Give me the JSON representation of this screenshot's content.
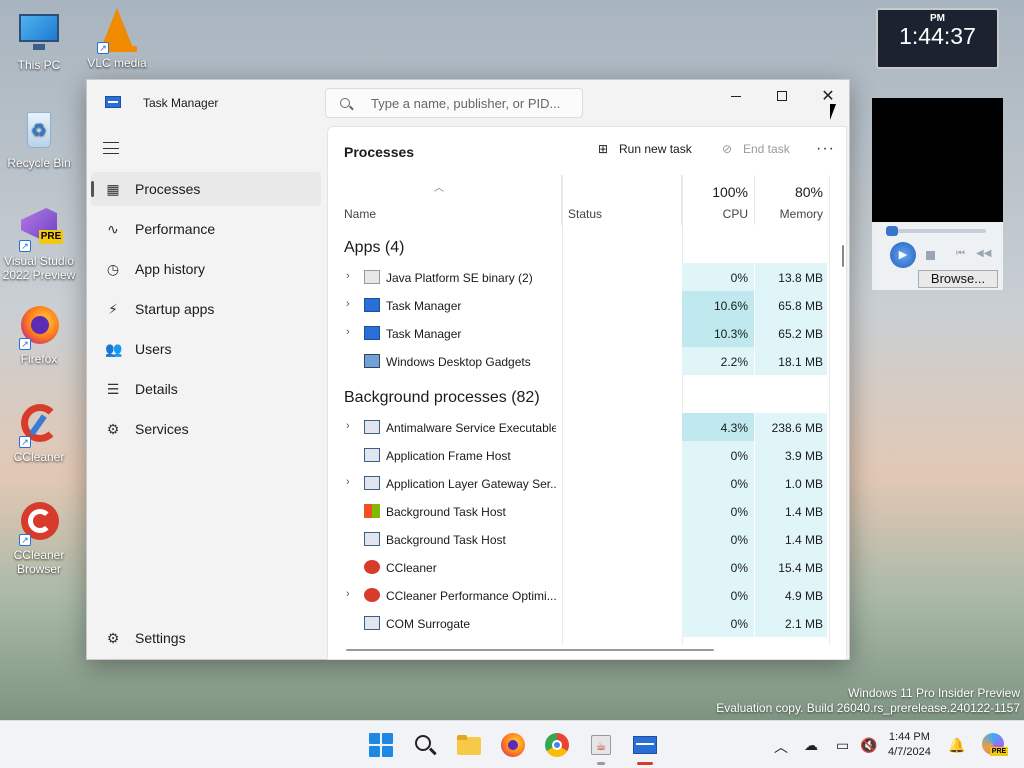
{
  "desktop": {
    "icons": [
      {
        "label": "This PC"
      },
      {
        "label": "VLC media"
      },
      {
        "label": "Recycle Bin"
      },
      {
        "label": "Visual Studio 2022 Preview"
      },
      {
        "label": "Firefox"
      },
      {
        "label": "CCleaner"
      },
      {
        "label": "CCleaner Browser"
      }
    ],
    "vs_badge": "PRE"
  },
  "window": {
    "title": "Task Manager",
    "search_placeholder": "Type a name, publisher, or PID..."
  },
  "nav": {
    "items": [
      {
        "label": "Processes",
        "icon": "processes-icon"
      },
      {
        "label": "Performance",
        "icon": "performance-icon"
      },
      {
        "label": "App history",
        "icon": "app-history-icon"
      },
      {
        "label": "Startup apps",
        "icon": "startup-icon"
      },
      {
        "label": "Users",
        "icon": "users-icon"
      },
      {
        "label": "Details",
        "icon": "details-icon"
      },
      {
        "label": "Services",
        "icon": "services-icon"
      }
    ],
    "settings": "Settings",
    "active": "Processes"
  },
  "content": {
    "title": "Processes",
    "run_new_task": "Run new task",
    "end_task": "End task",
    "columns": {
      "name": "Name",
      "status": "Status",
      "cpu_pct": "100%",
      "cpu": "CPU",
      "mem_pct": "80%",
      "memory": "Memory"
    },
    "apps_header": "Apps (4)",
    "bg_header": "Background processes (82)",
    "apps": [
      {
        "name": "Java Platform SE binary (2)",
        "cpu": "0%",
        "mem": "13.8 MB",
        "expand": true,
        "icon": "java-icon"
      },
      {
        "name": "Task Manager",
        "cpu": "10.6%",
        "mem": "65.8 MB",
        "expand": true,
        "icon": "task-manager-icon"
      },
      {
        "name": "Task Manager",
        "cpu": "10.3%",
        "mem": "65.2 MB",
        "expand": true,
        "icon": "task-manager-icon"
      },
      {
        "name": "Windows Desktop Gadgets",
        "cpu": "2.2%",
        "mem": "18.1 MB",
        "expand": false,
        "icon": "gadgets-icon"
      }
    ],
    "background": [
      {
        "name": "Antimalware Service Executable",
        "cpu": "4.3%",
        "mem": "238.6 MB",
        "expand": true,
        "icon": "service-icon"
      },
      {
        "name": "Application Frame Host",
        "cpu": "0%",
        "mem": "3.9 MB",
        "expand": false,
        "icon": "service-icon"
      },
      {
        "name": "Application Layer Gateway Ser...",
        "cpu": "0%",
        "mem": "1.0 MB",
        "expand": true,
        "icon": "service-icon"
      },
      {
        "name": "Background Task Host",
        "cpu": "0%",
        "mem": "1.4 MB",
        "expand": false,
        "icon": "windows-icon"
      },
      {
        "name": "Background Task Host",
        "cpu": "0%",
        "mem": "1.4 MB",
        "expand": false,
        "icon": "service-icon"
      },
      {
        "name": "CCleaner",
        "cpu": "0%",
        "mem": "15.4 MB",
        "expand": false,
        "icon": "ccleaner-icon"
      },
      {
        "name": "CCleaner Performance Optimi...",
        "cpu": "0%",
        "mem": "4.9 MB",
        "expand": true,
        "icon": "ccleaner-icon"
      },
      {
        "name": "COM Surrogate",
        "cpu": "0%",
        "mem": "2.1 MB",
        "expand": false,
        "icon": "service-icon"
      }
    ]
  },
  "clock": {
    "ampm": "PM",
    "time": "1:44:37"
  },
  "player": {
    "browse": "Browse..."
  },
  "watermark": {
    "line1": "Windows 11 Pro Insider Preview",
    "line2": "Evaluation copy. Build 26040.rs_prerelease.240122-1157"
  },
  "taskbar": {
    "time": "1:44 PM",
    "date": "4/7/2024",
    "copilot_badge": "PRE"
  },
  "colors": {
    "accent": "#2a6fd6",
    "cpu_heat_high": "#bfe9ee",
    "cpu_heat_low": "#dff5f7"
  }
}
